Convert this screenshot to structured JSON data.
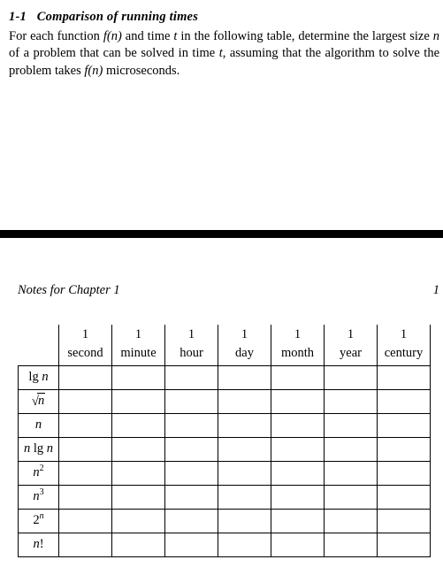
{
  "heading": {
    "number": "1-1",
    "title": "Comparison of running times"
  },
  "prompt": {
    "p1a": "For each function ",
    "p1b": " and time ",
    "p1c": " in the following table, determine the largest size ",
    "p1d": " of a problem that can be solved in time ",
    "p1e": ", assuming that the algorithm to solve the problem takes ",
    "p1f": " microseconds.",
    "sym_fn": "f(n)",
    "sym_t": "t",
    "sym_n": "n",
    "sym_fn2": "f(n)"
  },
  "notes": {
    "left": "Notes for Chapter 1",
    "right": "1"
  },
  "table": {
    "col_top": [
      "1",
      "1",
      "1",
      "1",
      "1",
      "1",
      "1"
    ],
    "col_units": [
      "second",
      "minute",
      "hour",
      "day",
      "month",
      "year",
      "century"
    ],
    "rows": [
      {
        "kind": "lgn"
      },
      {
        "kind": "sqrtn"
      },
      {
        "kind": "n"
      },
      {
        "kind": "nlgn"
      },
      {
        "kind": "n2"
      },
      {
        "kind": "n3"
      },
      {
        "kind": "2n"
      },
      {
        "kind": "nfact"
      }
    ]
  }
}
